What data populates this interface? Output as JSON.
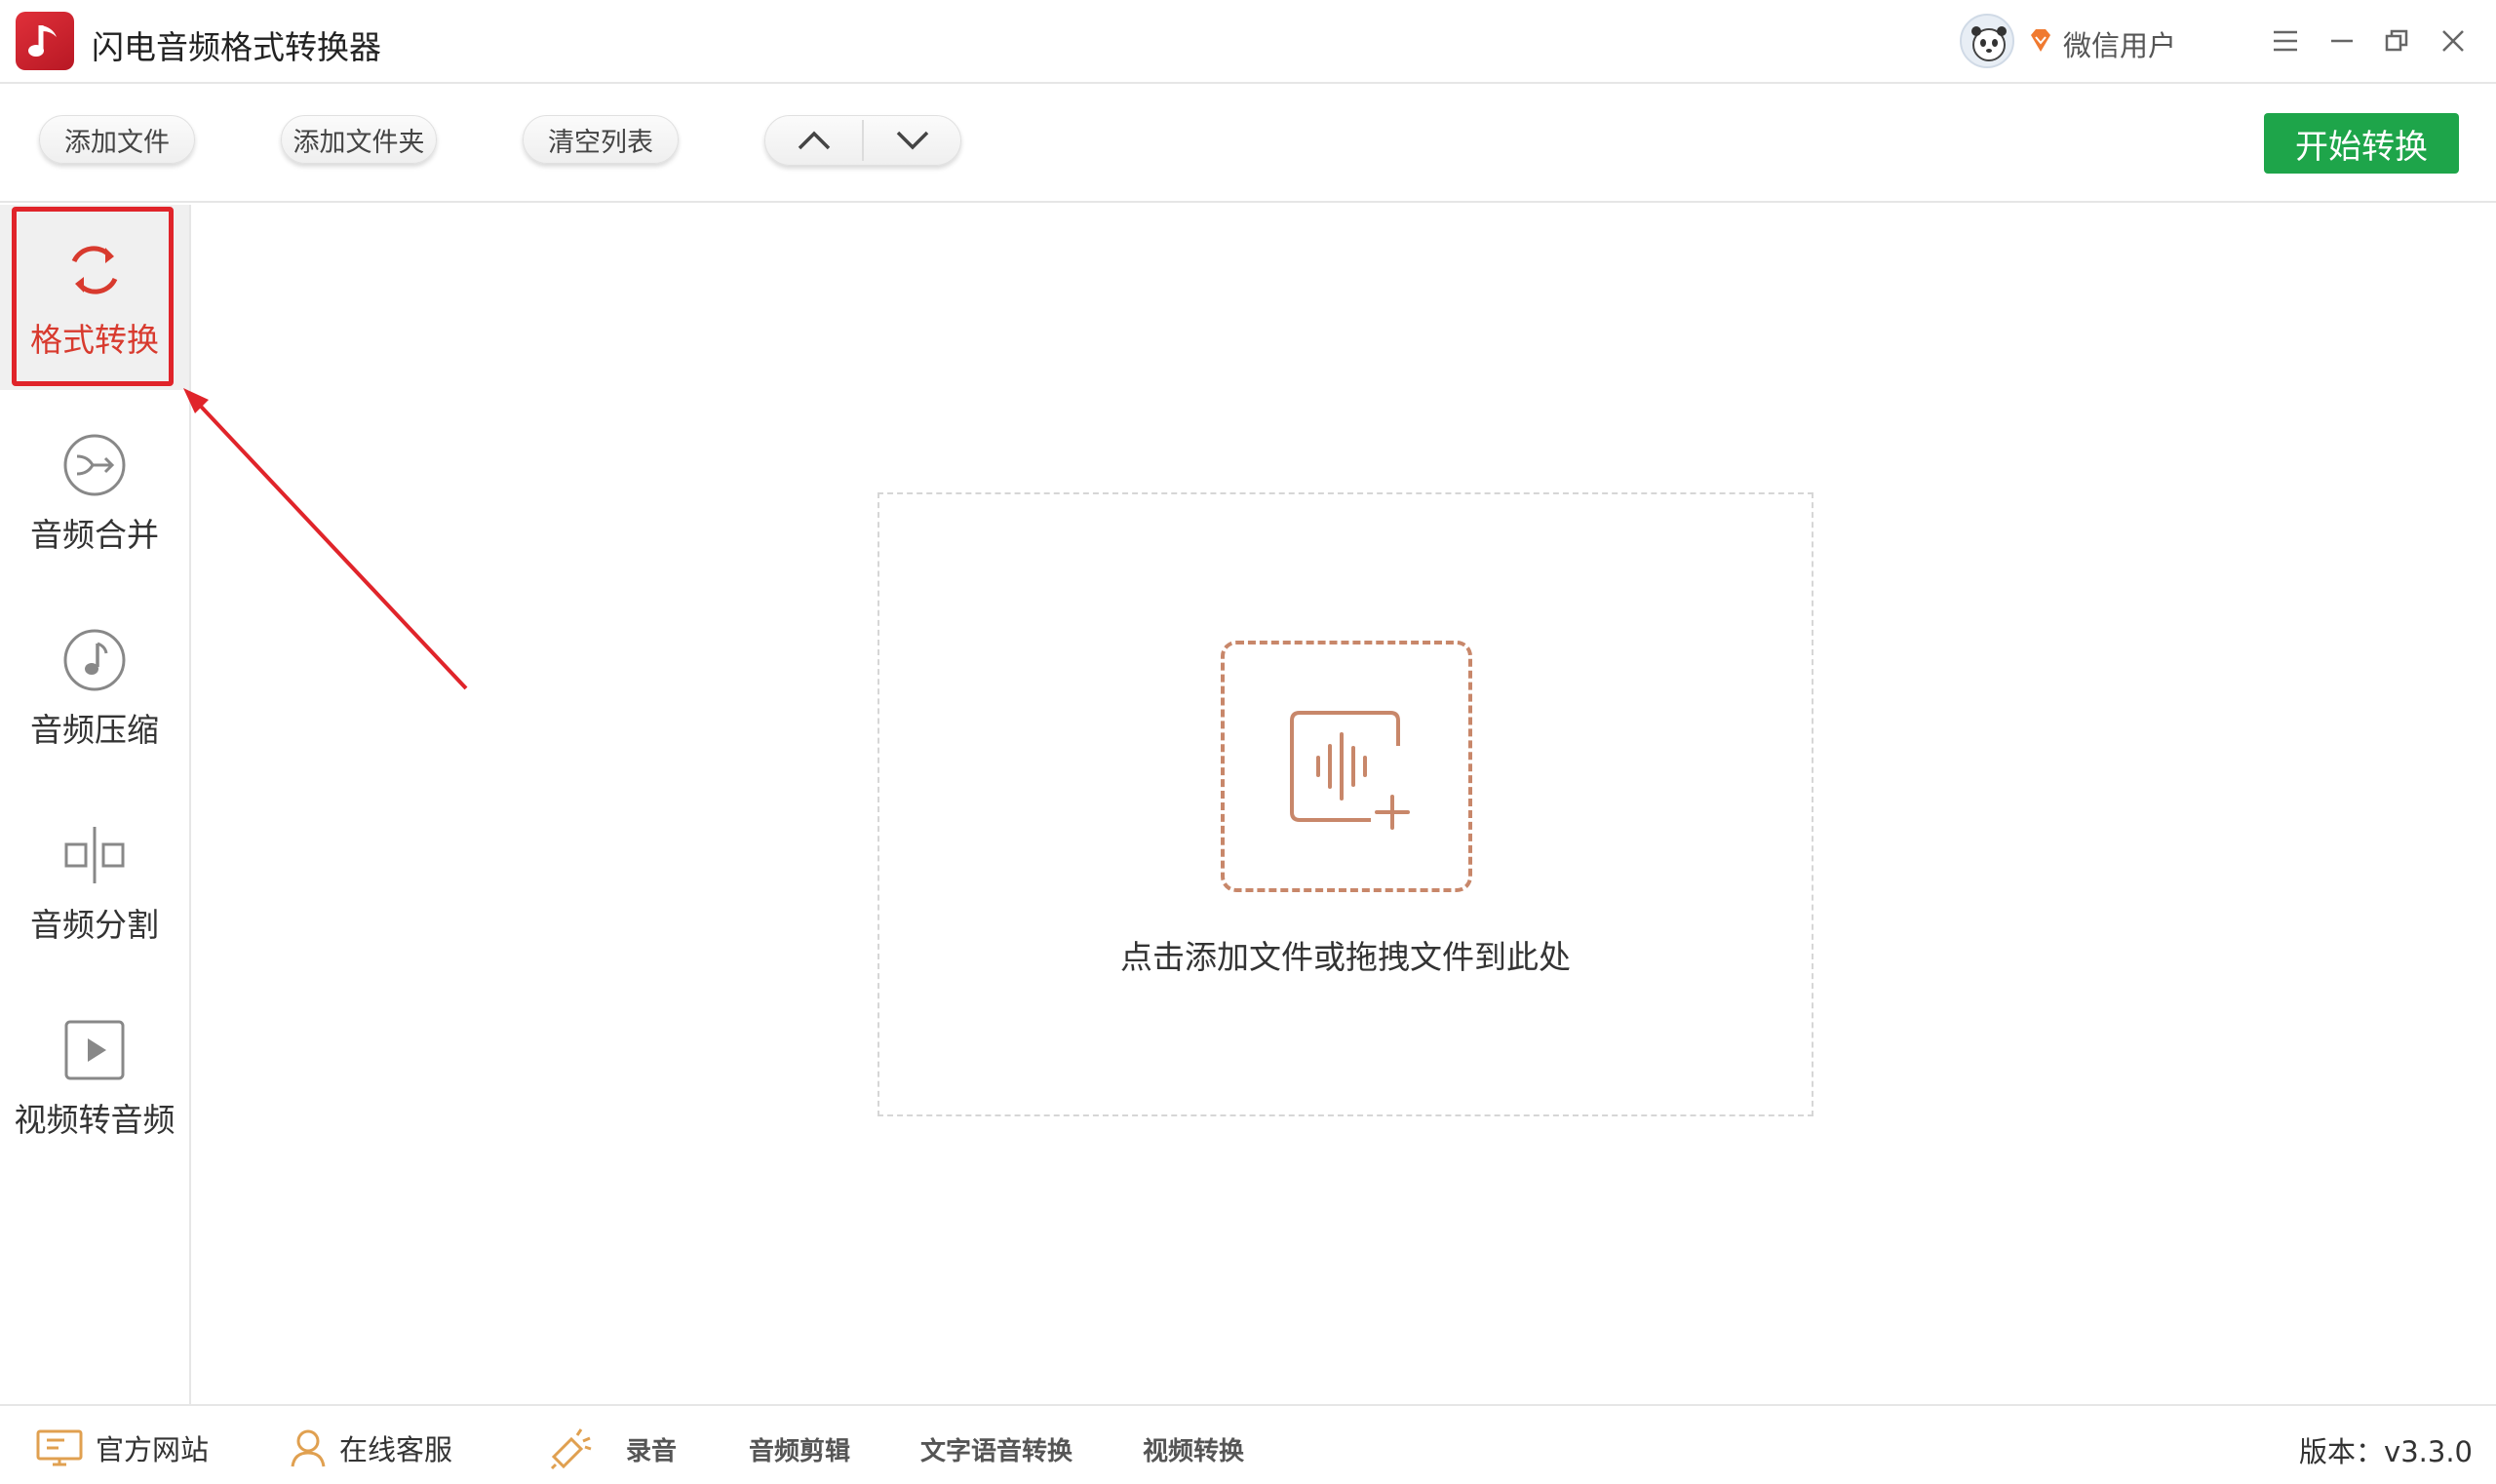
{
  "app": {
    "title": "闪电音频格式转换器",
    "user_name": "微信用户"
  },
  "toolbar": {
    "add_file": "添加文件",
    "add_folder": "添加文件夹",
    "clear_list": "清空列表",
    "start": "开始转换"
  },
  "sidebar": {
    "items": [
      {
        "label": "格式转换",
        "icon": "refresh-icon",
        "active": true
      },
      {
        "label": "音频合并",
        "icon": "merge-icon",
        "active": false
      },
      {
        "label": "音频压缩",
        "icon": "music-note-icon",
        "active": false
      },
      {
        "label": "音频分割",
        "icon": "split-icon",
        "active": false
      },
      {
        "label": "视频转音频",
        "icon": "video-play-icon",
        "active": false
      }
    ]
  },
  "main": {
    "drop_hint": "点击添加文件或拖拽文件到此处"
  },
  "footer": {
    "website": "官方网站",
    "support": "在线客服",
    "record": "录音",
    "audio_edit": "音频剪辑",
    "tts": "文字语音转换",
    "video_convert": "视频转换",
    "version": "版本：v3.3.0"
  },
  "colors": {
    "accent": "#d83a2e",
    "start": "#1ea54a",
    "drop_icon": "#c8876a",
    "highlight": "#e0242a"
  }
}
